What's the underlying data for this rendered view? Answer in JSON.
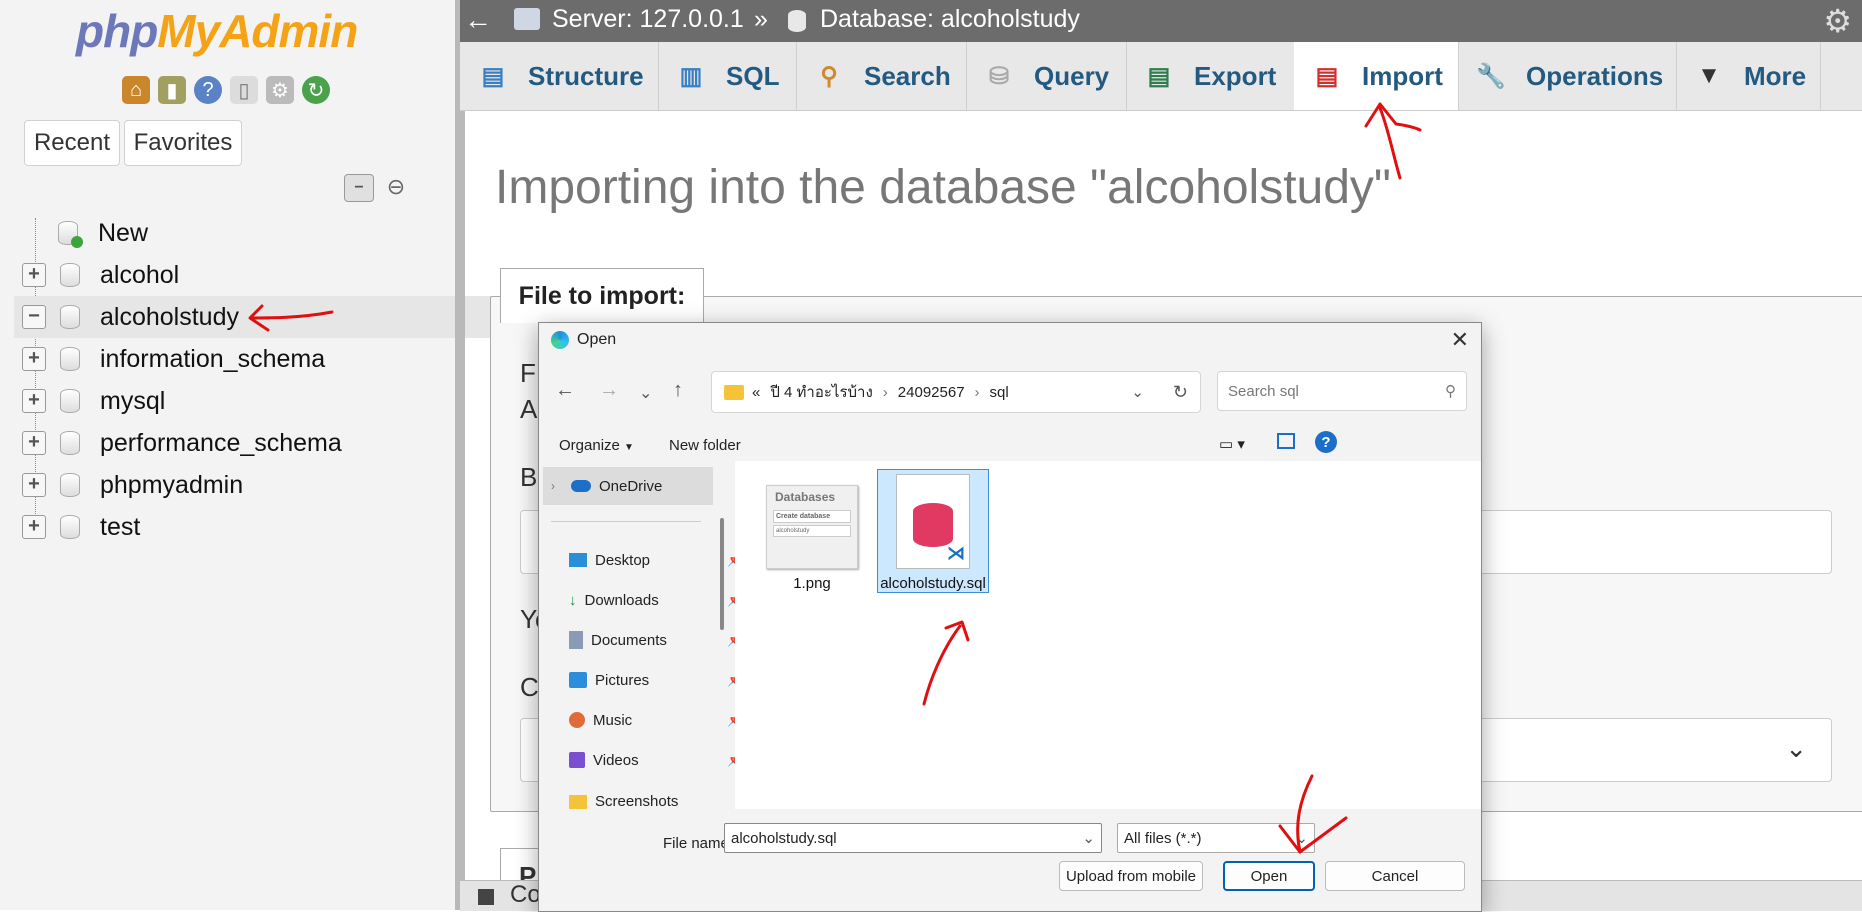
{
  "sidebar": {
    "logo_php": "php",
    "logo_myadmin": "MyAdmin",
    "tool_icons": [
      "home-icon",
      "logout-icon",
      "help-icon",
      "docs-icon",
      "settings-icon",
      "reload-icon"
    ],
    "recent_label": "Recent",
    "favorites_label": "Favorites",
    "databases": [
      {
        "label": "New"
      },
      {
        "label": "alcohol"
      },
      {
        "label": "alcoholstudy"
      },
      {
        "label": "information_schema"
      },
      {
        "label": "mysql"
      },
      {
        "label": "performance_schema"
      },
      {
        "label": "phpmyadmin"
      },
      {
        "label": "test"
      }
    ]
  },
  "topbar": {
    "server": "Server: 127.0.0.1",
    "separator": "»",
    "database": "Database: alcoholstudy"
  },
  "tabs": [
    {
      "label": "Structure",
      "icon": "structure-icon"
    },
    {
      "label": "SQL",
      "icon": "sql-icon"
    },
    {
      "label": "Search",
      "icon": "search-icon"
    },
    {
      "label": "Query",
      "icon": "query-icon"
    },
    {
      "label": "Export",
      "icon": "export-icon"
    },
    {
      "label": "Import",
      "icon": "import-icon"
    },
    {
      "label": "Operations",
      "icon": "wrench-icon"
    },
    {
      "label": "More",
      "icon": "chevron-down-icon"
    }
  ],
  "main": {
    "title": "Importing into the database \"alcoholstudy\"",
    "file_to_import": "File to import:",
    "obscured_letters": [
      "F",
      "A",
      "B",
      "Yo",
      "C",
      "P",
      "Co"
    ]
  },
  "dialog": {
    "title": "Open",
    "breadcrumb_prefix": "«",
    "breadcrumb": [
      "ปี 4 ทำอะไรบ้าง",
      "24092567",
      "sql"
    ],
    "search_placeholder": "Search sql",
    "organize_label": "Organize",
    "new_folder_label": "New folder",
    "nav": {
      "onedrive": "OneDrive",
      "items": [
        "Desktop",
        "Downloads",
        "Documents",
        "Pictures",
        "Music",
        "Videos",
        "Screenshots"
      ]
    },
    "files": [
      {
        "name": "1.png",
        "thumb_title": "Databases",
        "thumb_button": "Create database",
        "thumb_input": "alcoholstudy"
      },
      {
        "name": "alcoholstudy.sql"
      }
    ],
    "file_name_label": "File name:",
    "file_name_value": "alcoholstudy.sql",
    "file_type_value": "All files (*.*)",
    "upload_label": "Upload from mobile",
    "open_label": "Open",
    "cancel_label": "Cancel"
  },
  "colors": {
    "accent_blue": "#235a81",
    "annotation_red": "#e01010",
    "selected_file": "#cce8ff"
  }
}
